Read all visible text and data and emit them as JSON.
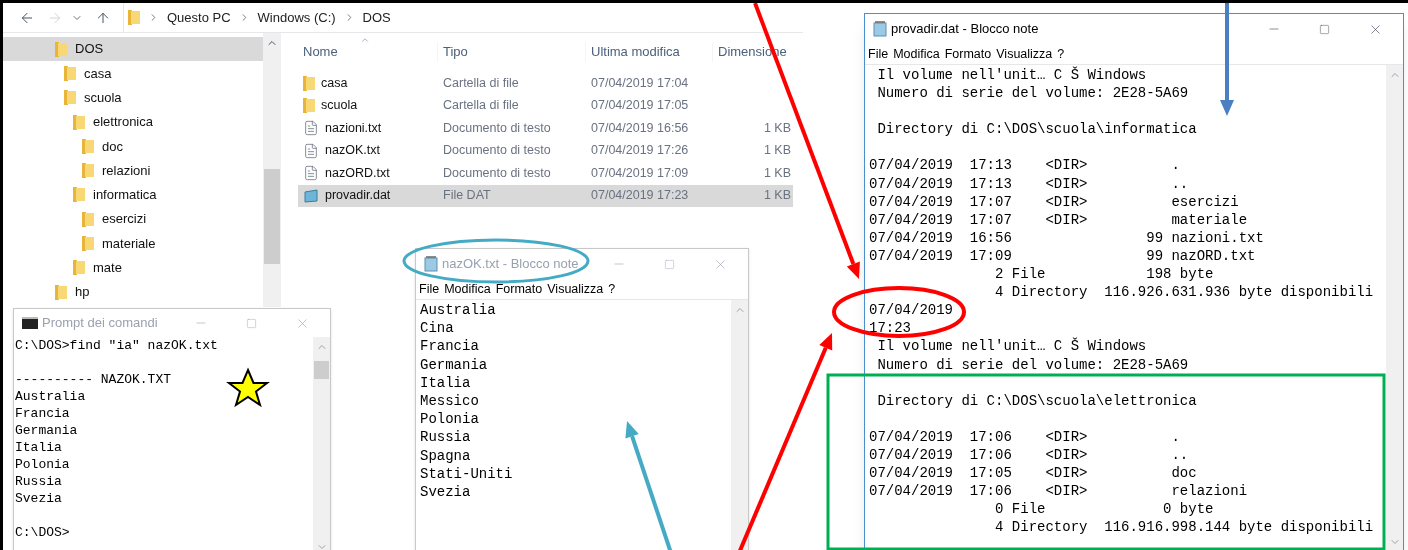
{
  "explorer": {
    "breadcrumb": [
      "Questo PC",
      "Windows (C:)",
      "DOS"
    ],
    "tree": [
      {
        "label": "DOS",
        "selected": true,
        "children": [
          {
            "label": "casa",
            "selected": false
          },
          {
            "label": "scuola",
            "selected": false,
            "children": [
              {
                "label": "elettronica",
                "selected": false,
                "children": [
                  {
                    "label": "doc",
                    "selected": false
                  },
                  {
                    "label": "relazioni",
                    "selected": false
                  }
                ]
              },
              {
                "label": "informatica",
                "selected": false,
                "children": [
                  {
                    "label": "esercizi",
                    "selected": false
                  },
                  {
                    "label": "materiale",
                    "selected": false
                  }
                ]
              },
              {
                "label": "mate",
                "selected": false
              }
            ]
          }
        ]
      },
      {
        "label": "hp",
        "selected": false
      }
    ],
    "columns": [
      "Nome",
      "Tipo",
      "Ultima modifica",
      "Dimensione"
    ],
    "files": [
      {
        "kind": "folder",
        "name": "casa",
        "type": "Cartella di file",
        "modified": "07/04/2019 17:04",
        "selected": false
      },
      {
        "kind": "folder",
        "name": "scuola",
        "type": "Cartella di file",
        "modified": "07/04/2019 17:05",
        "selected": false
      },
      {
        "kind": "text",
        "name": "nazioni.txt",
        "type": "Documento di testo",
        "modified": "07/04/2019 16:56",
        "size": "1 KB",
        "selected": false
      },
      {
        "kind": "text",
        "name": "nazOK.txt",
        "type": "Documento di testo",
        "modified": "07/04/2019 17:26",
        "size": "1 KB",
        "selected": false
      },
      {
        "kind": "text",
        "name": "nazORD.txt",
        "type": "Documento di testo",
        "modified": "07/04/2019 17:09",
        "size": "1 KB",
        "selected": false
      },
      {
        "kind": "dat",
        "name": "provadir.dat",
        "type": "File DAT",
        "modified": "07/04/2019 17:23",
        "size": "1 KB",
        "selected": true
      }
    ]
  },
  "console": {
    "title": "Prompt dei comandi",
    "active": false,
    "blocks": [
      [
        "C:\\DOS>find \"ia\" nazOK.txt"
      ],
      [
        "---------- NAZOK.TXT",
        "Australia",
        "Francia",
        "Germania",
        "Italia",
        "Polonia",
        "Russia",
        "Svezia"
      ],
      [
        "C:\\DOS>"
      ]
    ]
  },
  "notepad_list": {
    "title": "nazOK.txt - Blocco note",
    "active": false,
    "menu": [
      "File",
      "Modifica",
      "Formato",
      "Visualizza",
      "?"
    ],
    "blocks": [
      [
        "Australia",
        "Cina",
        "Francia",
        "Germania",
        "Italia",
        "Messico",
        "Polonia",
        "Russia",
        "Spagna",
        "Stati-Uniti",
        "Svezia"
      ]
    ]
  },
  "notepad_dir": {
    "title": "provadir.dat - Blocco note",
    "active": true,
    "menu": [
      "File",
      "Modifica",
      "Formato",
      "Visualizza",
      "?"
    ],
    "blocks": [
      [
        " Il volume nell'unit… C Š Windows",
        " Numero di serie del volume: 2E28-5A69"
      ],
      [
        " Directory di C:\\DOS\\scuola\\informatica"
      ],
      [
        "07/04/2019  17:13    <DIR>          .",
        "07/04/2019  17:13    <DIR>          ..",
        "07/04/2019  17:07    <DIR>          esercizi",
        "07/04/2019  17:07    <DIR>          materiale",
        "07/04/2019  16:56                99 nazioni.txt",
        "07/04/2019  17:09                99 nazORD.txt",
        "               2 File            198 byte",
        "               4 Directory  116.926.631.936 byte disponibili",
        "07/04/2019",
        "17:23",
        " Il volume nell'unit… C Š Windows",
        " Numero di serie del volume: 2E28-5A69"
      ],
      [
        " Directory di C:\\DOS\\scuola\\elettronica"
      ],
      [
        "07/04/2019  17:06    <DIR>          .",
        "07/04/2019  17:06    <DIR>          ..",
        "07/04/2019  17:05    <DIR>          doc",
        "07/04/2019  17:06    <DIR>          relazioni",
        "               0 File              0 byte",
        "               4 Directory  116.916.998.144 byte disponibili"
      ]
    ]
  }
}
